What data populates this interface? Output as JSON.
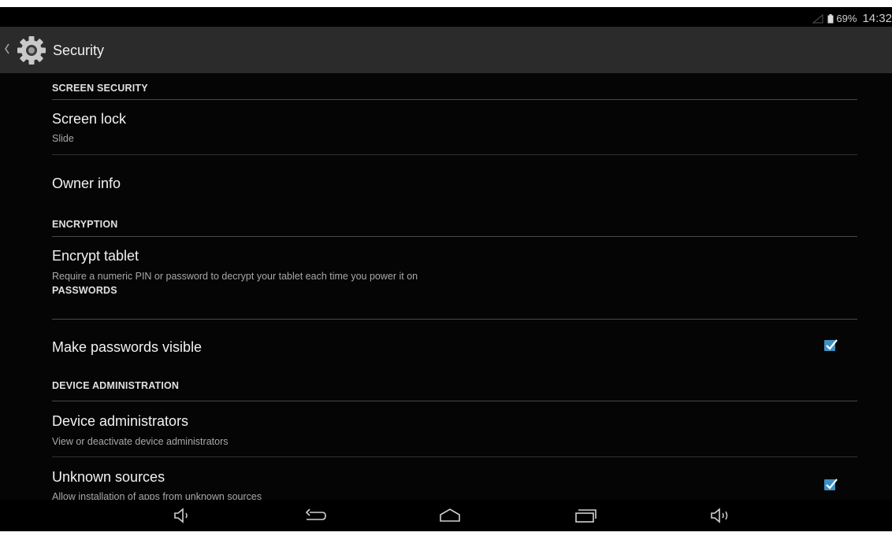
{
  "status_bar": {
    "battery": "69%",
    "time": "14:32",
    "icons": [
      "signal-icon",
      "battery-icon"
    ]
  },
  "action_bar": {
    "title": "Security",
    "icons": [
      "chevron-left-icon",
      "gear-icon"
    ]
  },
  "sections": {
    "screen_security": {
      "header": "SCREEN SECURITY",
      "screen_lock": {
        "title": "Screen lock",
        "summary": "Slide"
      },
      "owner_info": {
        "title": "Owner info"
      }
    },
    "encryption": {
      "header": "ENCRYPTION",
      "encrypt_tablet": {
        "title": "Encrypt tablet",
        "summary": "Require a numeric PIN or password to decrypt your tablet each time you power it on"
      }
    },
    "passwords": {
      "header": "PASSWORDS",
      "make_passwords_visible": {
        "title": "Make passwords visible",
        "checked": true
      }
    },
    "device_administration": {
      "header": "DEVICE ADMINISTRATION",
      "device_administrators": {
        "title": "Device administrators",
        "summary": "View or deactivate device administrators"
      },
      "unknown_sources": {
        "title": "Unknown sources",
        "summary": "Allow installation of apps from unknown sources",
        "checked": true
      }
    }
  },
  "nav_bar": {
    "icons": [
      "volume-down-icon",
      "back-icon",
      "home-icon",
      "recent-apps-icon",
      "volume-up-icon"
    ]
  },
  "colors": {
    "accent": "#3f8fc2",
    "background": "#050505",
    "action_bar": "#2b2b2b"
  }
}
